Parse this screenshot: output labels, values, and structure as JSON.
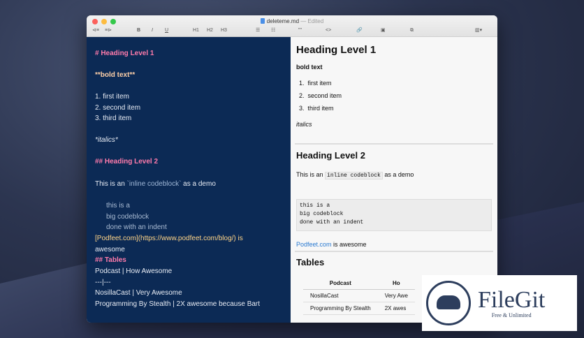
{
  "window": {
    "filename": "deleteme.md",
    "status": "— Edited"
  },
  "toolbar": {
    "nav_back": "⊲≡",
    "nav_fwd": "≡⊳",
    "bold": "B",
    "italic": "I",
    "underline": "U",
    "h1": "H1",
    "h2": "H2",
    "h3": "H3",
    "quote": "\"\"",
    "code": "<>",
    "sidebar": "▥▾"
  },
  "editor": {
    "lines": [
      "# Heading Level 1",
      "**bold text**",
      "1. first item",
      "2. second item",
      "3. third item",
      "*italics*",
      "## Heading Level 2",
      "This is an ",
      "`inline codeblock`",
      " as a demo",
      "this is a",
      "big codeblock",
      "done with an indent",
      "[Podfeet.com](https://www.podfeet.com/blog/) is",
      "awesome",
      "## Tables",
      "Podcast | How Awesome",
      "---|---",
      "NosillaCast | Very Awesome",
      "Programming By Stealth | 2X awesome because Bart"
    ]
  },
  "preview": {
    "h1": "Heading Level 1",
    "bold": "bold text",
    "list": [
      "first item",
      "second item",
      "third item"
    ],
    "list_nums": [
      "1.",
      "2.",
      "3."
    ],
    "italics": "italics",
    "h2": "Heading Level 2",
    "para_pre": "This is an ",
    "para_code": "inline codeblock",
    "para_post": " as a demo",
    "codeblock": [
      "this is a",
      "big codeblock",
      "done with an indent"
    ],
    "link": "Podfeet.com",
    "link_post": " is awesome",
    "h_tables": "Tables",
    "table": {
      "headers": [
        "Podcast",
        "Ho"
      ],
      "rows": [
        [
          "NosillaCast",
          "Very Awe"
        ],
        [
          "Programming By Stealth",
          "2X awes"
        ]
      ]
    }
  },
  "watermark": {
    "name": "FileGit",
    "tagline": "Free & Unlimited"
  }
}
